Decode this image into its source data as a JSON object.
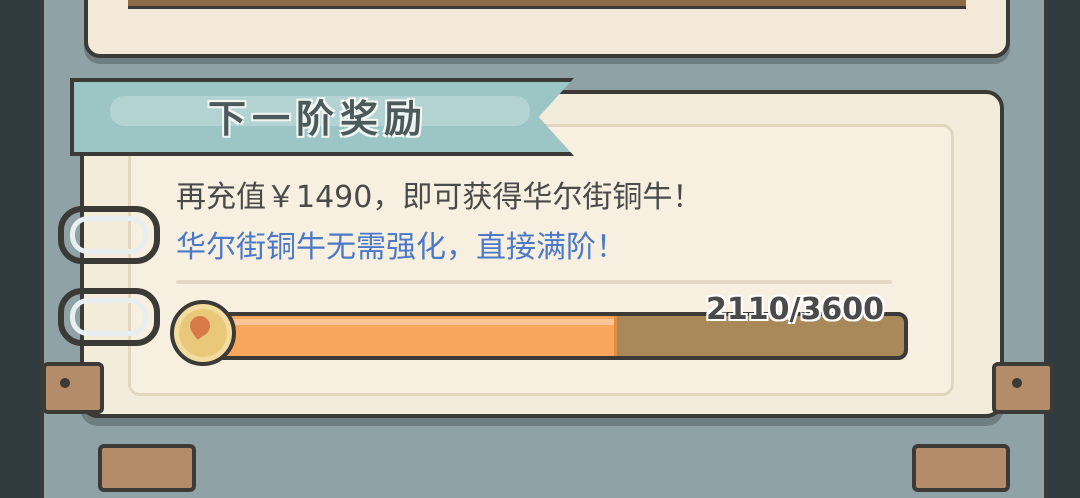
{
  "panel": {
    "title": "下一阶奖励",
    "line1": "再充值￥1490，即可获得华尔街铜牛！",
    "line2": "华尔街铜牛无需强化，直接满阶！"
  },
  "progress": {
    "current": 2110,
    "max": 3600,
    "text": "2110/3600",
    "fraction": 0.586
  },
  "colors": {
    "ribbon": "#9cc6c6",
    "line2": "#4b78c8",
    "progress_fill": "#f7a65b",
    "progress_track": "#a9885a"
  },
  "icons": {
    "coin": "coin-icon",
    "ring": "ring-binder-icon"
  }
}
